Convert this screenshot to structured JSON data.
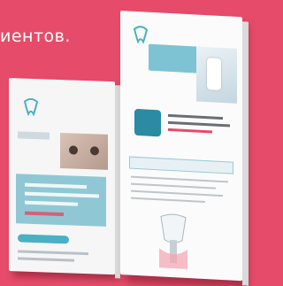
{
  "heading": {
    "text": "иентов."
  },
  "colors": {
    "background": "#e64c69",
    "teal": "#7ec3d3",
    "accent": "#e64c69"
  },
  "book_left": {
    "logo_icon": "tooth-logo-icon"
  },
  "book_right": {
    "logo_icon": "tooth-logo-icon"
  }
}
